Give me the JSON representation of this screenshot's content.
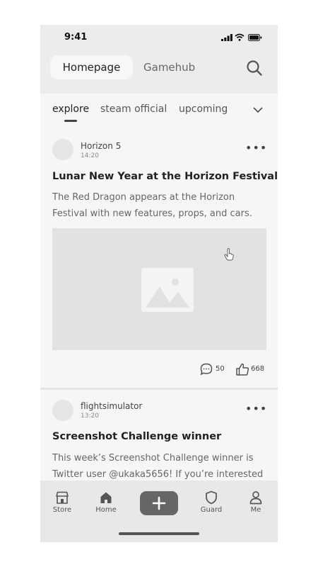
{
  "status_bar": {
    "time": "9:41"
  },
  "header": {
    "tabs": [
      {
        "label": "Homepage"
      },
      {
        "label": "Gamehub"
      }
    ]
  },
  "subnav": {
    "items": [
      {
        "label": "explore"
      },
      {
        "label": "steam official"
      },
      {
        "label": "upcoming"
      }
    ]
  },
  "posts": [
    {
      "author": "Horizon 5",
      "time": "14:20",
      "title": "Lunar New Year at the Horizon Festival",
      "body": "The Red Dragon appears at the Horizon Festival with new features, props, and cars.",
      "comments": "50",
      "likes": "668"
    },
    {
      "author": "flightsimulator",
      "time": "13:20",
      "title": "Screenshot Challenge winner",
      "body": "This week’s Screenshot Challenge winner is Twitter user @ukaka5656! If you’re interested"
    }
  ],
  "bottom_nav": {
    "items": [
      {
        "label": "Store"
      },
      {
        "label": "Home"
      },
      {
        "label": "Guard"
      },
      {
        "label": "Me"
      }
    ]
  }
}
